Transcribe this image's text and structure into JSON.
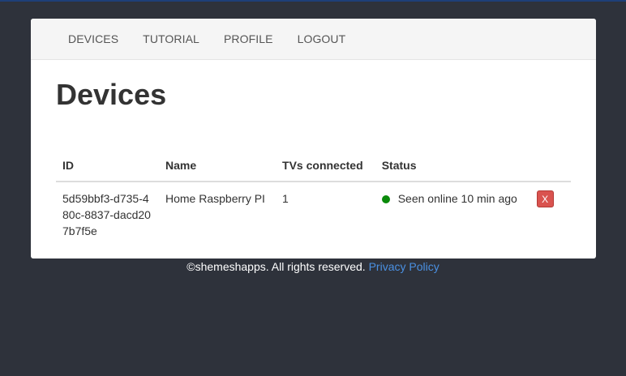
{
  "nav": {
    "items": [
      {
        "label": "DEVICES"
      },
      {
        "label": "TUTORIAL"
      },
      {
        "label": "PROFILE"
      },
      {
        "label": "LOGOUT"
      }
    ]
  },
  "main": {
    "title": "Devices",
    "table": {
      "headers": {
        "id": "ID",
        "name": "Name",
        "tvs": "TVs connected",
        "status": "Status"
      },
      "rows": [
        {
          "id": "5d59bbf3-d735-480c-8837-dacd207b7f5e",
          "name": "Home Raspberry PI",
          "tvs": "1",
          "status": "Seen online 10 min ago",
          "status_color": "#0a8a0a",
          "delete_label": "X"
        }
      ]
    }
  },
  "footer": {
    "copyright": "©shemeshapps. All rights reserved.",
    "privacy_link": "Privacy Policy"
  },
  "colors": {
    "background": "#2e323b",
    "link": "#4a90e2",
    "danger": "#d9534f",
    "online": "#0a8a0a"
  }
}
